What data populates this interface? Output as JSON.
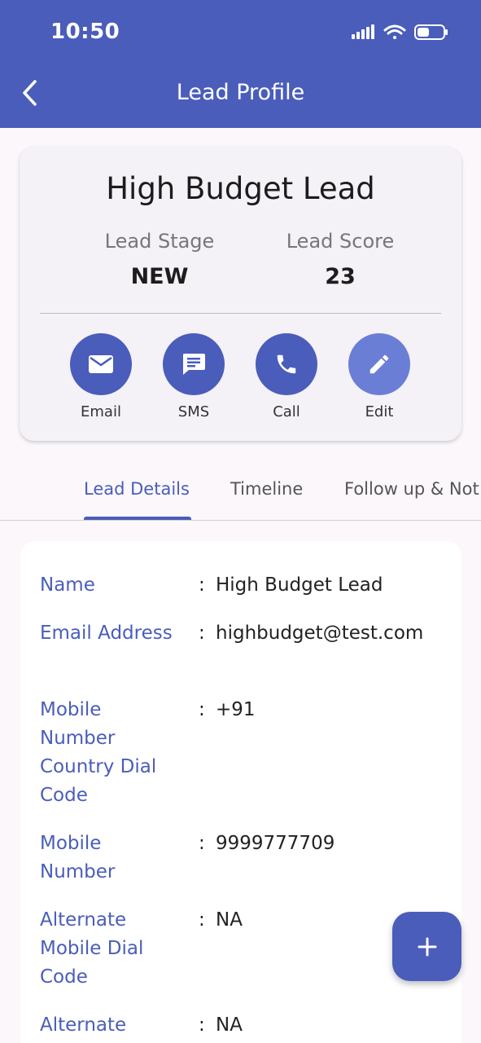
{
  "status_bar": {
    "time": "10:50"
  },
  "header": {
    "title": "Lead Profile"
  },
  "summary": {
    "name": "High Budget Lead",
    "stage_label": "Lead Stage",
    "stage_value": "NEW",
    "score_label": "Lead Score",
    "score_value": "23",
    "actions": [
      {
        "label": "Email",
        "icon": "mail-icon"
      },
      {
        "label": "SMS",
        "icon": "message-icon"
      },
      {
        "label": "Call",
        "icon": "phone-icon"
      },
      {
        "label": "Edit",
        "icon": "pencil-icon"
      }
    ]
  },
  "tabs": [
    {
      "label": "Lead Details",
      "active": true
    },
    {
      "label": "Timeline",
      "active": false
    },
    {
      "label": "Follow up & Not",
      "active": false
    }
  ],
  "details": [
    {
      "label": "Name",
      "value": "High Budget Lead"
    },
    {
      "label": "Email Address",
      "value": "highbudget@test.com"
    },
    {
      "label": "Mobile Number Country Dial Code",
      "value": "+91"
    },
    {
      "label": "Mobile Number",
      "value": "9999777709"
    },
    {
      "label": "Alternate Mobile Dial Code",
      "value": "NA"
    },
    {
      "label": "Alternate",
      "value": "NA"
    }
  ],
  "colon": ":",
  "fab": {
    "icon": "plus-icon"
  },
  "colors": {
    "primary": "#4a5dbb",
    "edit_button": "#6a7ed6",
    "background": "#fbf7fb"
  }
}
